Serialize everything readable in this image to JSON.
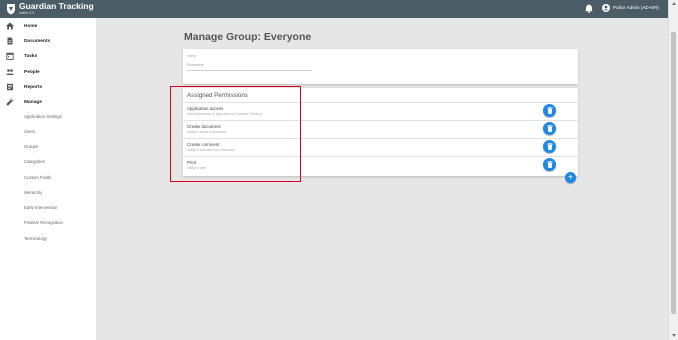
{
  "app": {
    "title": "Guardian Tracking",
    "subtitle": "online 2.0",
    "user": "Police Admin (AD-MR)"
  },
  "sidebar": {
    "items": [
      {
        "label": "Home",
        "icon": "home-icon"
      },
      {
        "label": "Documents",
        "icon": "document-icon"
      },
      {
        "label": "Tasks",
        "icon": "calendar-icon"
      },
      {
        "label": "People",
        "icon": "people-icon"
      },
      {
        "label": "Reports",
        "icon": "report-icon"
      },
      {
        "label": "Manage",
        "icon": "wrench-icon"
      }
    ],
    "manage_items": [
      "Application Settings",
      "Users",
      "Groups",
      "Categories",
      "Custom Fields",
      "Hierarchy",
      "Early Intervention",
      "Positive Recognition",
      "Terminology"
    ]
  },
  "main": {
    "title": "Manage Group: Everyone",
    "name_field": {
      "label": "Name",
      "value": "Everyone"
    },
    "permissions": {
      "header": "Assigned Permissions",
      "items": [
        {
          "name": "Application access",
          "desc": "Grant permission to login and use Guardian Tracking"
        },
        {
          "name": "Create document",
          "desc": "Ability to create a document"
        },
        {
          "name": "Create comment",
          "desc": "Ability to comment on a document"
        },
        {
          "name": "Print",
          "desc": "Ability to print"
        }
      ]
    },
    "add_label": "+"
  },
  "colors": {
    "topbar": "#4a5d66",
    "accent": "#1e88e5",
    "highlight": "#d0021b"
  }
}
